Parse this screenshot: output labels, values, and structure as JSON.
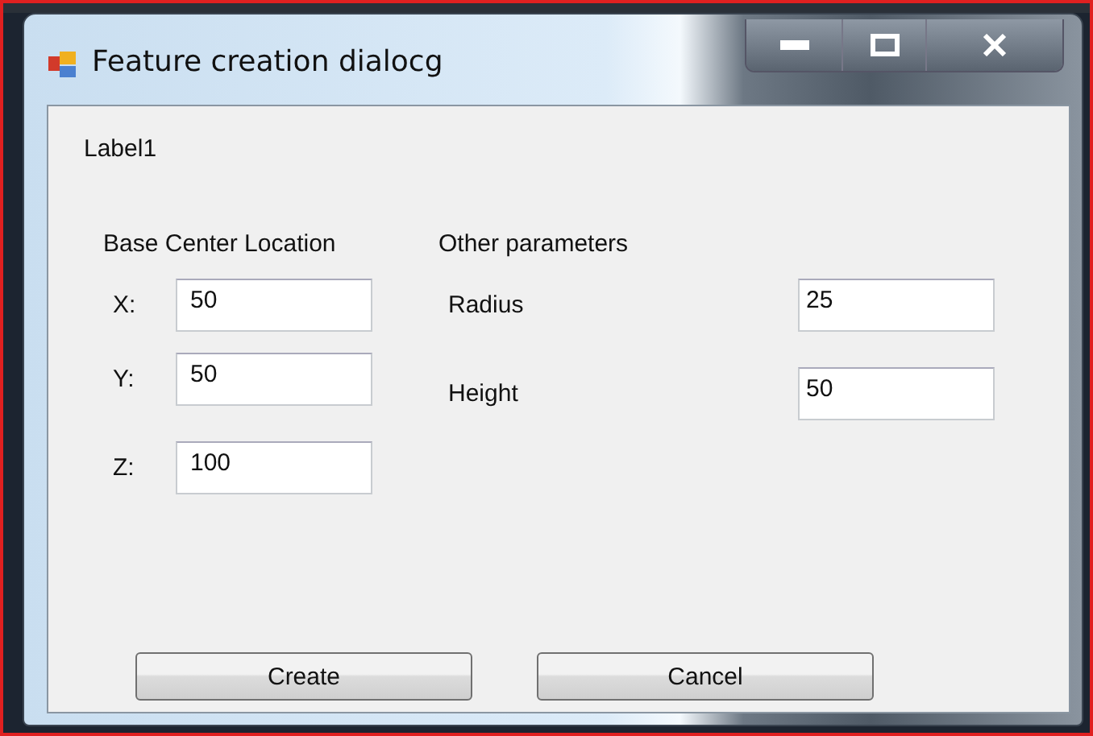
{
  "window": {
    "title": "Feature creation dialocg"
  },
  "label": "Label1",
  "groups": [
    {
      "heading": "Base Center Location",
      "fields": [
        {
          "label": "X:",
          "value": "50"
        },
        {
          "label": "Y:",
          "value": "50"
        },
        {
          "label": "Z:",
          "value": "100"
        }
      ]
    },
    {
      "heading": "Other parameters",
      "fields": [
        {
          "label": "Radius",
          "value": "25"
        },
        {
          "label": "Height",
          "value": "50"
        }
      ]
    }
  ],
  "buttons": [
    "Create",
    "Cancel"
  ]
}
